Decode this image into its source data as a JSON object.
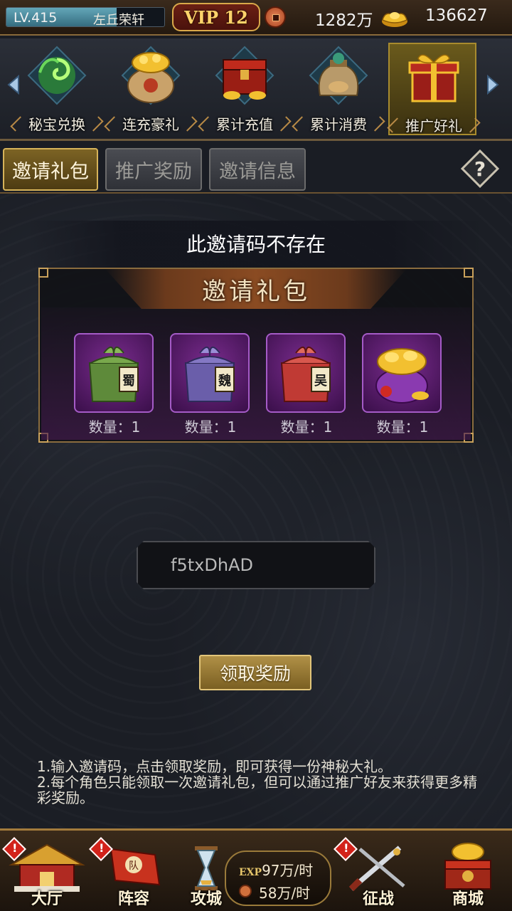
{
  "topbar": {
    "level_label": "LV.415",
    "level_progress": 0.7,
    "player_name": "左丘荣轩",
    "vip_label": "VIP 12",
    "copper": "1282万",
    "gold": "136627"
  },
  "activities": [
    {
      "label": "秘宝兑换",
      "icon": "green-swirl-icon"
    },
    {
      "label": "连充豪礼",
      "icon": "gold-sack-icon"
    },
    {
      "label": "累计充值",
      "icon": "treasure-chest-icon"
    },
    {
      "label": "累计消费",
      "icon": "pouch-icon"
    },
    {
      "label": "推广好礼",
      "icon": "gift-box-icon",
      "selected": true
    }
  ],
  "tabs": [
    {
      "label": "邀请礼包",
      "active": true
    },
    {
      "label": "推广奖励",
      "active": false
    },
    {
      "label": "邀请信息",
      "active": false
    }
  ],
  "main": {
    "message": "此邀请码不存在",
    "panel_title": "邀请礼包",
    "gifts": [
      {
        "seal": "蜀",
        "qty": "数量：1",
        "color": "#5e8a3a"
      },
      {
        "seal": "魏",
        "qty": "数量：1",
        "color": "#6a5eaa"
      },
      {
        "seal": "吴",
        "qty": "数量：1",
        "color": "#c03a34"
      },
      {
        "seal": "",
        "qty": "数量：1",
        "color": "#e0b030"
      }
    ],
    "invite_code": "f5txDhAD",
    "claim_label": "领取奖励",
    "rules": [
      "1.输入邀请码，点击领取奖励，即可获得一份神秘大礼。",
      "2.每个角色只能领取一次邀请礼包，但可以通过推广好友来获得更多精彩奖励。"
    ]
  },
  "nav": {
    "items": [
      {
        "label": "大厅",
        "badge": true
      },
      {
        "label": "阵容",
        "badge": true
      },
      {
        "label": "攻城",
        "badge": false
      },
      {
        "label": "征战",
        "badge": true
      },
      {
        "label": "商城",
        "badge": false
      }
    ],
    "exp_tag": "EXP",
    "exp_rate": "97万/时",
    "copper_rate": "58万/时"
  }
}
